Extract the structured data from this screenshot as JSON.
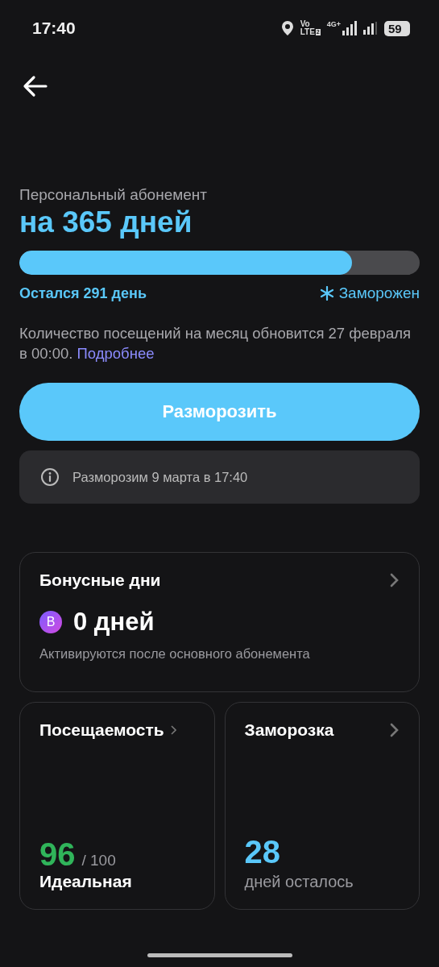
{
  "status_bar": {
    "time": "17:40",
    "volte": "Vo",
    "lte": "LTE",
    "sim": "2",
    "network": "4G+",
    "battery": "59"
  },
  "subscription": {
    "label": "Персональный абонемент",
    "title": "на 365 дней",
    "level": 0.83,
    "remaining": "Остался 291 день",
    "frozen": true,
    "frozen_label": "Заморожен"
  },
  "notice": {
    "text": "Количество посещений на месяц обновится 27 февраля в 00:00.",
    "link": "Подробнее"
  },
  "unfreeze_button": "Разморозить",
  "info": {
    "text": "Разморозим 9 марта в 17:40"
  },
  "bonus_card": {
    "title": "Бонусные дни",
    "badge": "B",
    "value": "0 дней",
    "caption": "Активируются после основного абонемента"
  },
  "cards": [
    {
      "kind": "score",
      "title": "Посещаемость",
      "value": "96",
      "max": "/ 100",
      "caption": "Идеальная"
    },
    {
      "kind": "count",
      "title": "Заморозка",
      "value": "28",
      "caption": "дней осталось"
    }
  ]
}
